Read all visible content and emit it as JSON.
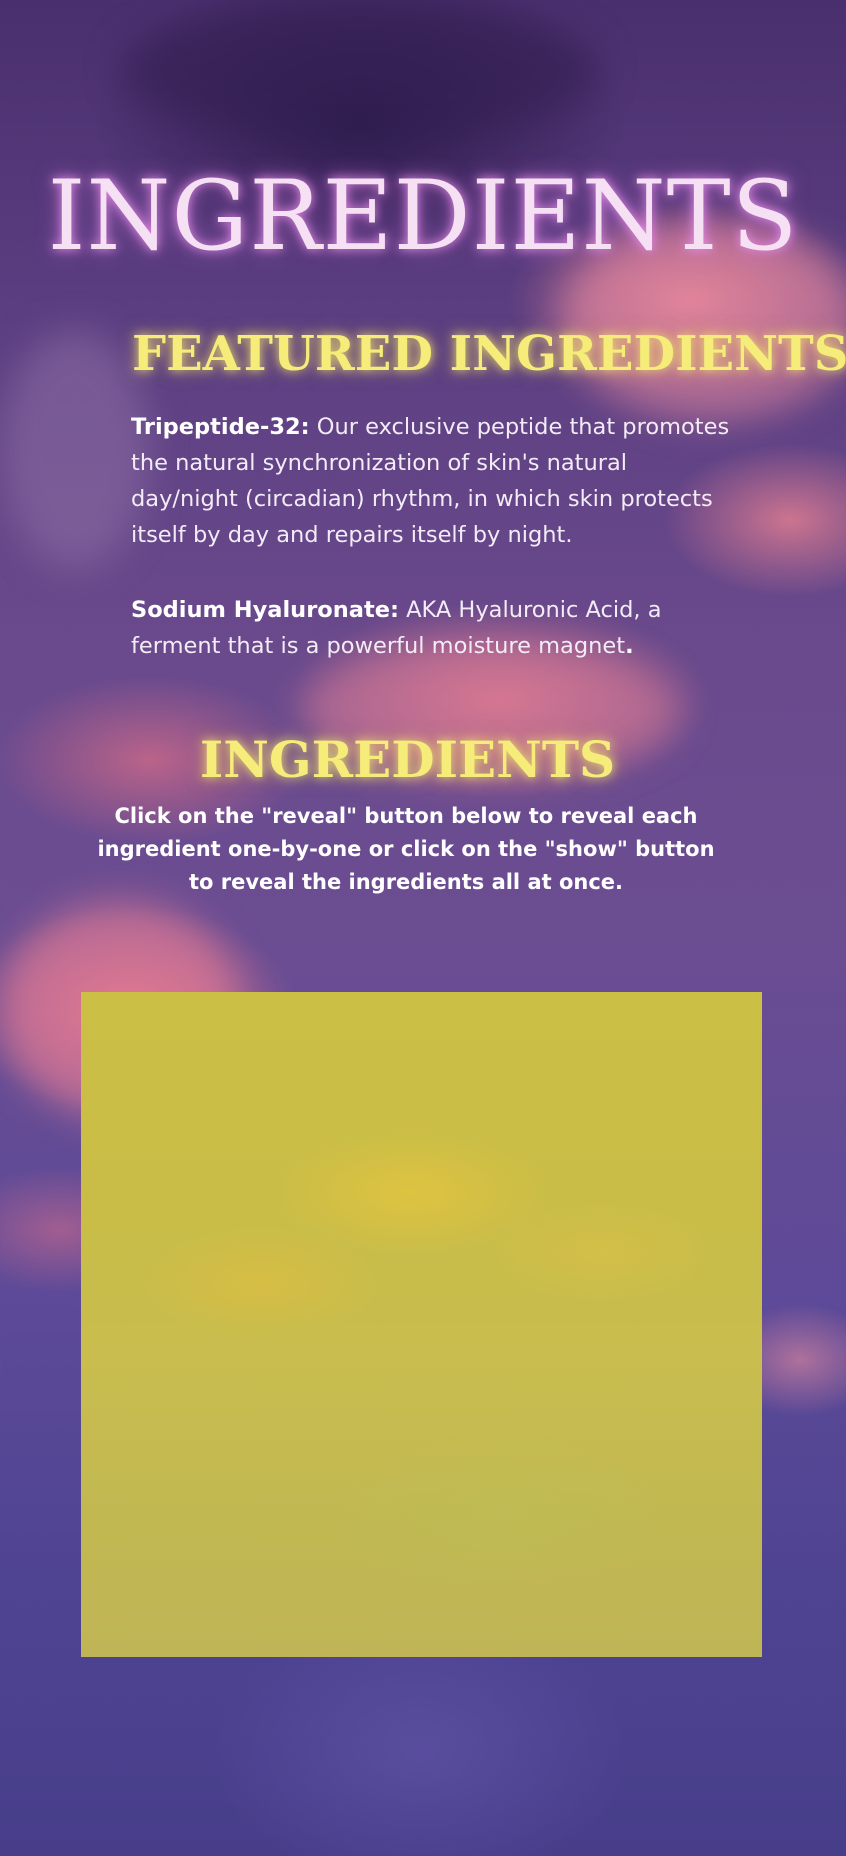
{
  "header": {
    "title": "INGREDIENTS"
  },
  "featured": {
    "heading": "FEATURED INGREDIENTS",
    "items": [
      {
        "name": "Tripeptide-32:",
        "description": " Our exclusive peptide that promotes the natural synchronization of skin's natural day/night (circadian) rhythm, in which skin protects itself by day and repairs itself by night."
      },
      {
        "name": "Sodium Hyaluronate:",
        "description": " AKA Hyaluronic Acid, a ferment that is a powerful moisture magnet",
        "trailing": "."
      }
    ]
  },
  "ingredients": {
    "heading": "INGREDIENTS",
    "instructions": "Click on the \"reveal\" button below to reveal each ingredient one-by-one or click on the \"show\" button to reveal the ingredients all at once."
  },
  "colors": {
    "title_glow": "#f6e1f4",
    "heading_yellow": "#f6ec7a",
    "panel_yellow": "#c9bd47",
    "background_purple": "#5c3f82"
  }
}
